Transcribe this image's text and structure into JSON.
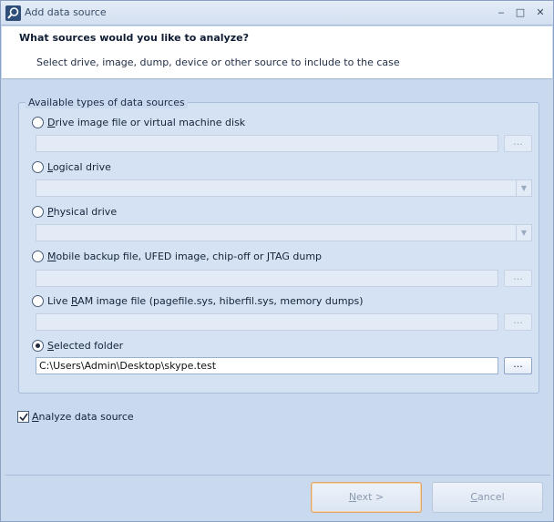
{
  "window": {
    "title": "Add data source",
    "controls": {
      "minimize": "‒",
      "maximize": "□",
      "close": "✕"
    }
  },
  "header": {
    "title": "What sources would you like to analyze?",
    "subtitle": "Select drive, image, dump, device or other source to include to the case"
  },
  "group": {
    "legend": "Available types of data sources",
    "options": [
      {
        "accel": "D",
        "rest": "rive image file or virtual machine disk",
        "selected": false,
        "input": "text",
        "value": ""
      },
      {
        "accel": "L",
        "rest": "ogical drive",
        "selected": false,
        "input": "combo",
        "value": ""
      },
      {
        "accel": "P",
        "rest": "hysical drive",
        "selected": false,
        "input": "combo",
        "value": ""
      },
      {
        "accel": "M",
        "rest": "obile backup file, UFED image, chip-off or JTAG dump",
        "selected": false,
        "input": "text",
        "value": ""
      },
      {
        "pre": "Live ",
        "accel": "R",
        "rest": "AM image file (pagefile.sys, hiberfil.sys, memory dumps)",
        "selected": false,
        "input": "text",
        "value": ""
      },
      {
        "accel": "S",
        "rest": "elected folder",
        "selected": true,
        "input": "text",
        "value": "C:\\Users\\Admin\\Desktop\\skype.test"
      }
    ],
    "browse_label": "..."
  },
  "analyze": {
    "accel": "A",
    "rest": "nalyze data source",
    "checked": true
  },
  "buttons": {
    "next": {
      "accel": "N",
      "rest": "ext >"
    },
    "cancel": {
      "accel": "C",
      "rest": "ancel"
    }
  },
  "colors": {
    "accent_border": "#e1a46a",
    "background": "#c9d9ee"
  }
}
